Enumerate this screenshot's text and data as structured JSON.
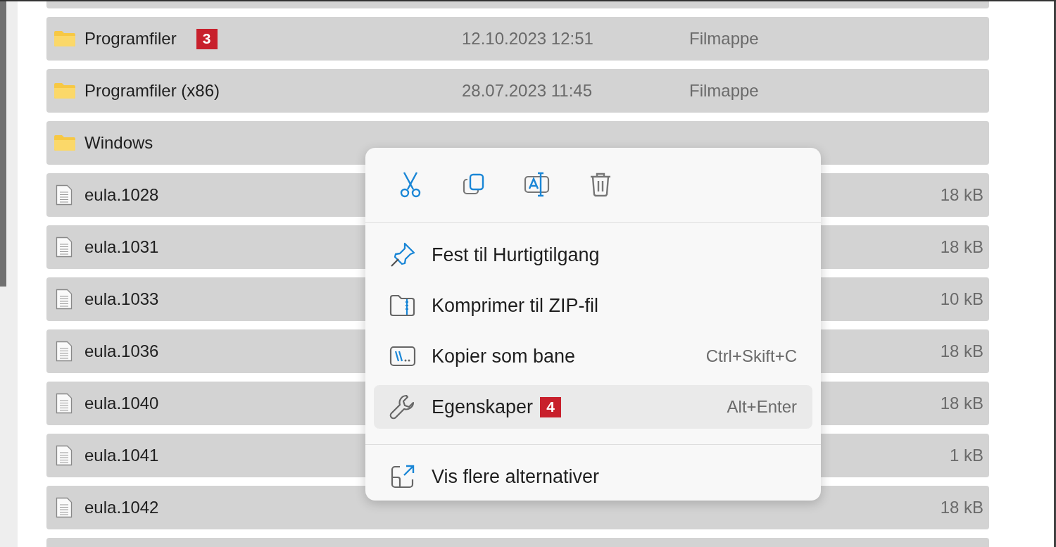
{
  "file_list": {
    "rows": [
      {
        "selected": true
      },
      {
        "kind": "folder",
        "name": "Programfiler",
        "badge": "3",
        "date": "12.10.2023 12:51",
        "type": "Filmappe",
        "selected": true
      },
      {
        "kind": "folder",
        "name": "Programfiler (x86)",
        "date": "28.07.2023 11:45",
        "type": "Filmappe",
        "selected": true
      },
      {
        "kind": "folder",
        "name": "Windows",
        "selected": true
      },
      {
        "kind": "file",
        "name": "eula.1028",
        "size": "18 kB",
        "selected": true
      },
      {
        "kind": "file",
        "name": "eula.1031",
        "size": "18 kB",
        "selected": true
      },
      {
        "kind": "file",
        "name": "eula.1033",
        "size": "10 kB",
        "selected": true
      },
      {
        "kind": "file",
        "name": "eula.1036",
        "size": "18 kB",
        "selected": true
      },
      {
        "kind": "file",
        "name": "eula.1040",
        "size": "18 kB",
        "selected": true
      },
      {
        "kind": "file",
        "name": "eula.1041",
        "size": "1 kB",
        "selected": true
      },
      {
        "kind": "file",
        "name": "eula.1042",
        "size": "18 kB",
        "selected": true
      },
      {
        "selected": true
      }
    ]
  },
  "context_menu": {
    "toolbar": [
      {
        "kind": "cut"
      },
      {
        "kind": "copy"
      },
      {
        "kind": "rename"
      },
      {
        "kind": "delete"
      }
    ],
    "sections": [
      [
        {
          "kind": "pin",
          "label": "Fest til Hurtigtilgang",
          "selected": false
        },
        {
          "kind": "zip",
          "label": "Komprimer til ZIP-fil",
          "selected": false
        },
        {
          "kind": "path",
          "label": "Kopier som bane",
          "shortcut": "Ctrl+Skift+C",
          "selected": false
        },
        {
          "kind": "wrench",
          "label": "Egenskaper",
          "badge": "4",
          "shortcut": "Alt+Enter",
          "selected": true
        }
      ],
      [
        {
          "kind": "more",
          "label": "Vis flere alternativer",
          "selected": false
        }
      ]
    ]
  }
}
